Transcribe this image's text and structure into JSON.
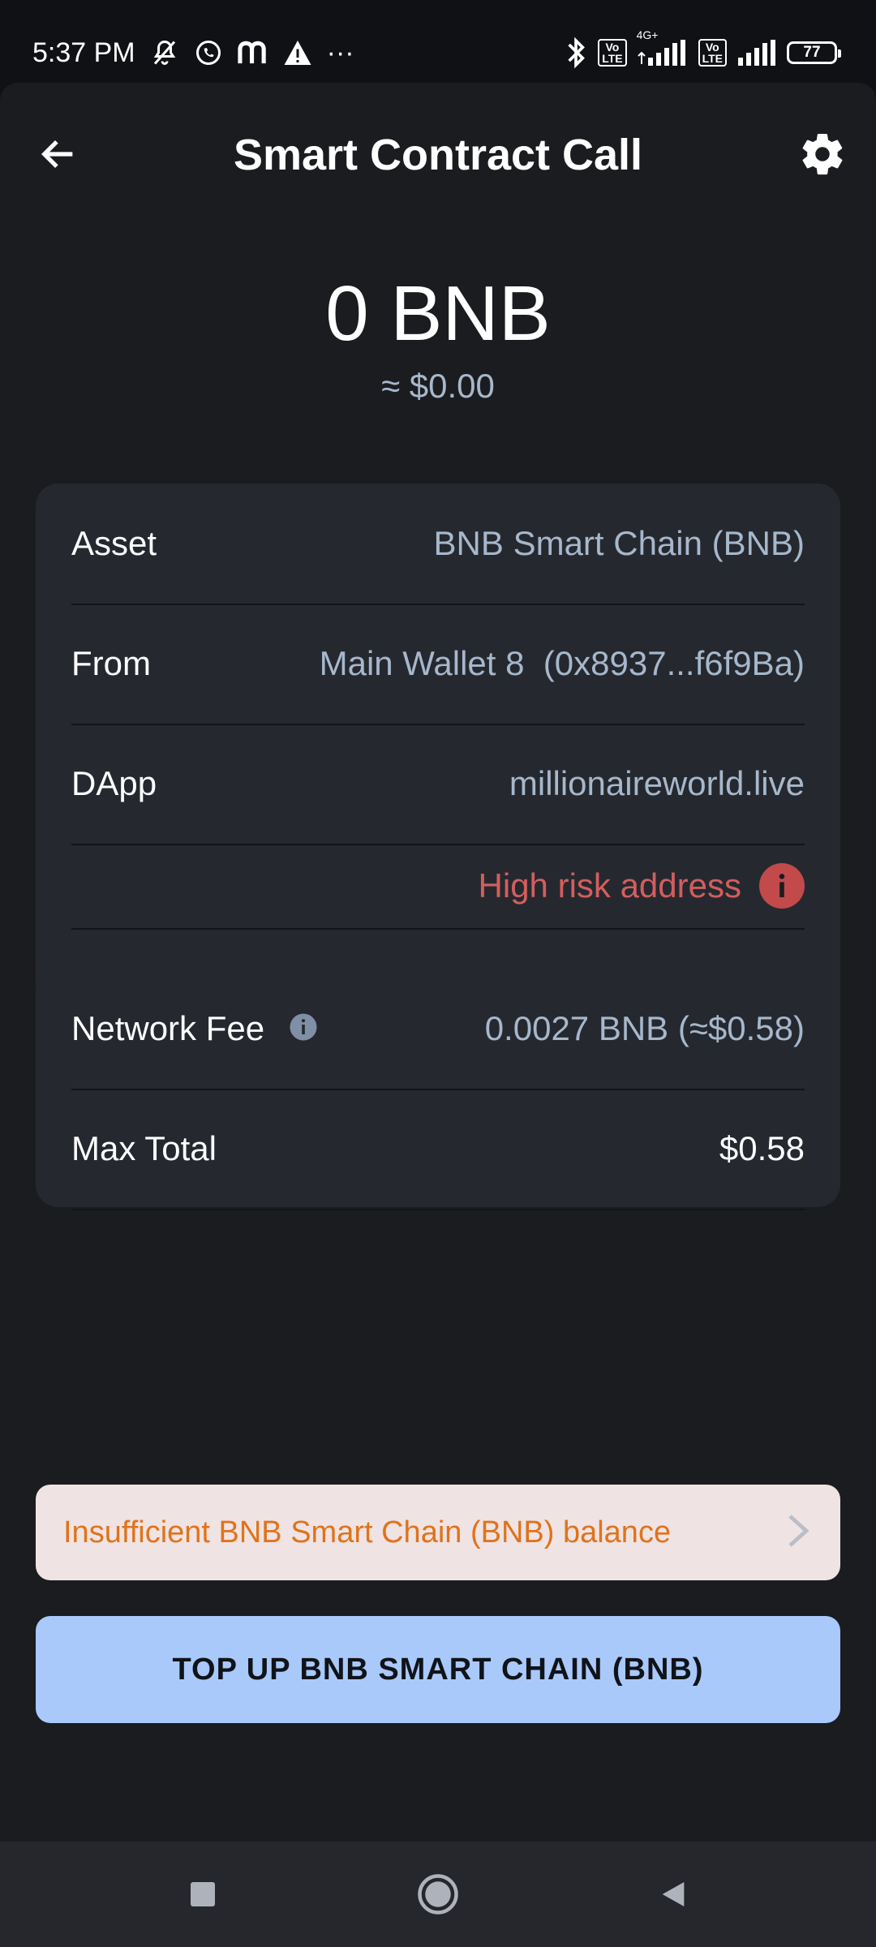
{
  "status_bar": {
    "time": "5:37 PM",
    "overflow": "···",
    "network_label": "4G+",
    "volte_1": "Vo\nLTE",
    "volte_2": "Vo\nLTE",
    "battery": "77",
    "icons": [
      "bell-muted-icon",
      "whatsapp-icon",
      "m-app-icon",
      "warning-icon",
      "bluetooth-icon",
      "signal-icon",
      "battery-icon"
    ]
  },
  "header": {
    "title": "Smart Contract Call",
    "back_icon": "arrow-left-icon",
    "settings_icon": "gear-icon"
  },
  "amount": {
    "value": "0 BNB",
    "fiat": "≈ $0.00"
  },
  "details": {
    "asset_label": "Asset",
    "asset_value": "BNB Smart Chain (BNB)",
    "from_label": "From",
    "from_value": "Main Wallet 8  (0x8937...f6f9Ba)",
    "dapp_label": "DApp",
    "dapp_value": "millionaireworld.live",
    "risk_text": "High risk address"
  },
  "fees": {
    "network_fee_label": "Network Fee",
    "network_fee_value": "0.0027 BNB (≈$0.58)",
    "max_total_label": "Max Total",
    "max_total_value": "$0.58"
  },
  "alert": {
    "text": "Insufficient BNB Smart Chain (BNB) balance"
  },
  "button": {
    "label": "TOP UP BNB SMART CHAIN (BNB)"
  },
  "colors": {
    "background": "#1b1c1f",
    "card": "#25292f",
    "muted_text": "#a7b7cc",
    "risk": "#d35e5e",
    "alert_bg": "#f0e3e3",
    "alert_text": "#e0731c",
    "button_bg": "#a9c9fb"
  }
}
